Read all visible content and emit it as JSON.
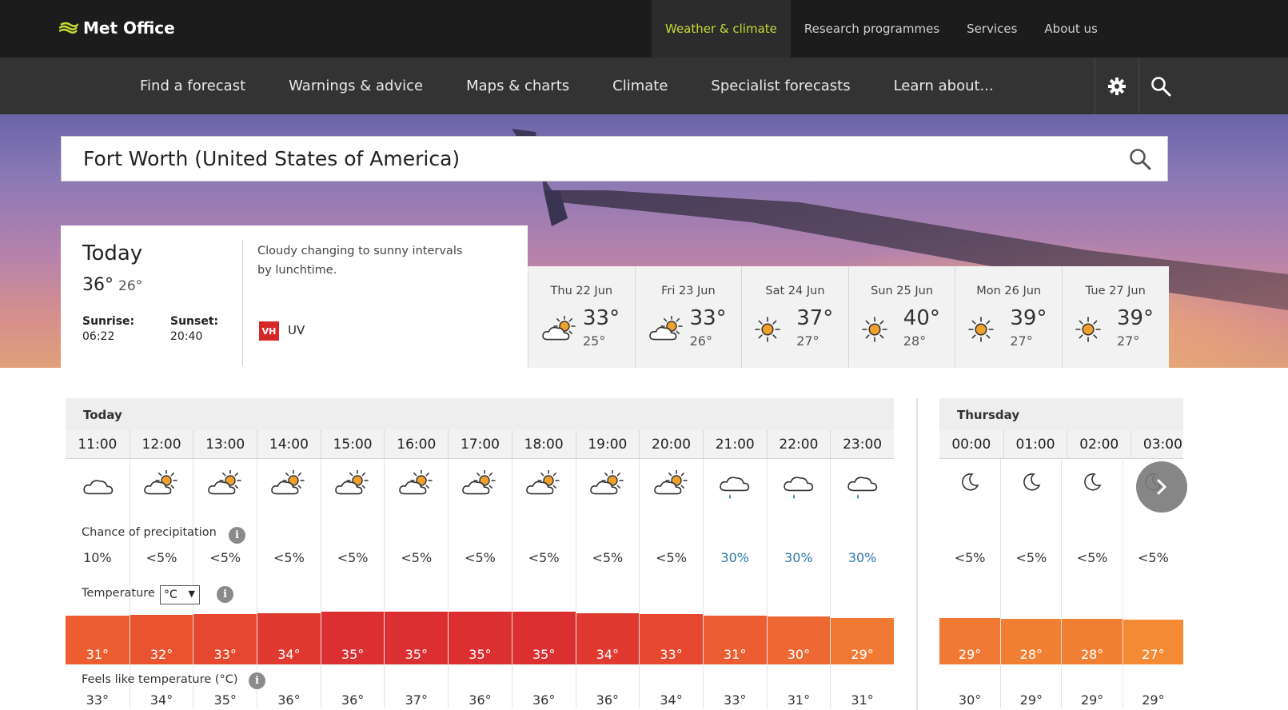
{
  "topnav": {
    "logo_text": "Met Office",
    "links": [
      "Weather & climate",
      "Research programmes",
      "Services",
      "About us"
    ],
    "active_index": 0
  },
  "mainnav": {
    "links": [
      "Find a forecast",
      "Warnings & advice",
      "Maps & charts",
      "Climate",
      "Specialist forecasts",
      "Learn about..."
    ],
    "settings_icon": "gear-icon",
    "search_icon": "search-icon"
  },
  "location_search": {
    "value": "Fort Worth (United States of America)"
  },
  "today": {
    "title": "Today",
    "high": "36°",
    "low": "26°",
    "sunrise_label": "Sunrise:",
    "sunrise": "06:22",
    "sunset_label": "Sunset:",
    "sunset": "20:40",
    "summary": "Cloudy changing to sunny intervals by lunchtime.",
    "uv_badge": "VH",
    "uv_label": "UV",
    "uv_color": "#d62728"
  },
  "days": [
    {
      "label": "Thu 22 Jun",
      "high": "33°",
      "low": "25°",
      "icon": "sunny-intervals-icon"
    },
    {
      "label": "Fri 23 Jun",
      "high": "33°",
      "low": "26°",
      "icon": "sunny-intervals-icon"
    },
    {
      "label": "Sat 24 Jun",
      "high": "37°",
      "low": "27°",
      "icon": "sunny-icon"
    },
    {
      "label": "Sun 25 Jun",
      "high": "40°",
      "low": "28°",
      "icon": "sunny-icon"
    },
    {
      "label": "Mon 26 Jun",
      "high": "39°",
      "low": "27°",
      "icon": "sunny-icon"
    },
    {
      "label": "Tue 27 Jun",
      "high": "39°",
      "low": "27°",
      "icon": "sunny-icon"
    }
  ],
  "hourly_labels": {
    "precip": "Chance of precipitation",
    "temperature": "Temperature",
    "unit": "°C",
    "feels": "Feels like temperature (°C)",
    "info_glyph": "i"
  },
  "today_hourly": {
    "title": "Today",
    "hours": [
      {
        "time": "11:00",
        "icon": "cloudy",
        "precip": "10%",
        "temp": "31°",
        "temp_value": 31,
        "feels": "33°"
      },
      {
        "time": "12:00",
        "icon": "sunny-intervals",
        "precip": "<5%",
        "temp": "32°",
        "temp_value": 32,
        "feels": "34°"
      },
      {
        "time": "13:00",
        "icon": "sunny-intervals",
        "precip": "<5%",
        "temp": "33°",
        "temp_value": 33,
        "feels": "35°"
      },
      {
        "time": "14:00",
        "icon": "sunny-intervals",
        "precip": "<5%",
        "temp": "34°",
        "temp_value": 34,
        "feels": "36°"
      },
      {
        "time": "15:00",
        "icon": "sunny-intervals",
        "precip": "<5%",
        "temp": "35°",
        "temp_value": 35,
        "feels": "36°"
      },
      {
        "time": "16:00",
        "icon": "sunny-intervals",
        "precip": "<5%",
        "temp": "35°",
        "temp_value": 35,
        "feels": "37°"
      },
      {
        "time": "17:00",
        "icon": "sunny-intervals",
        "precip": "<5%",
        "temp": "35°",
        "temp_value": 35,
        "feels": "36°"
      },
      {
        "time": "18:00",
        "icon": "sunny-intervals",
        "precip": "<5%",
        "temp": "35°",
        "temp_value": 35,
        "feels": "36°"
      },
      {
        "time": "19:00",
        "icon": "sunny-intervals",
        "precip": "<5%",
        "temp": "34°",
        "temp_value": 34,
        "feels": "36°"
      },
      {
        "time": "20:00",
        "icon": "sunny-intervals",
        "precip": "<5%",
        "temp": "33°",
        "temp_value": 33,
        "feels": "34°"
      },
      {
        "time": "21:00",
        "icon": "light-shower",
        "precip": "30%",
        "temp": "31°",
        "temp_value": 31,
        "feels": "33°"
      },
      {
        "time": "22:00",
        "icon": "light-shower",
        "precip": "30%",
        "temp": "30°",
        "temp_value": 30,
        "feels": "31°"
      },
      {
        "time": "23:00",
        "icon": "light-shower",
        "precip": "30%",
        "temp": "29°",
        "temp_value": 29,
        "feels": "31°"
      }
    ]
  },
  "thursday_hourly": {
    "title": "Thursday",
    "hours": [
      {
        "time": "00:00",
        "icon": "clear-night",
        "precip": "<5%",
        "temp": "29°",
        "temp_value": 29,
        "feels": "30°"
      },
      {
        "time": "01:00",
        "icon": "clear-night",
        "precip": "<5%",
        "temp": "28°",
        "temp_value": 28,
        "feels": "29°"
      },
      {
        "time": "02:00",
        "icon": "clear-night",
        "precip": "<5%",
        "temp": "28°",
        "temp_value": 28,
        "feels": "29°"
      },
      {
        "time": "03:00",
        "icon": "clear-night",
        "precip": "<5%",
        "temp": "27°",
        "temp_value": 27,
        "feels": "29°"
      }
    ]
  },
  "colors": {
    "accent": "#c6da34",
    "precip_wet": "#2d78a7",
    "temp_35": "#dc2f32",
    "temp_34": "#e0392f",
    "temp_33": "#e5482e",
    "temp_32": "#e9532f",
    "temp_31": "#ec5e31",
    "temp_30": "#ee6833",
    "temp_29": "#f07a34",
    "temp_28": "#f28034",
    "temp_27": "#f48a34"
  },
  "scroll_button_icon": "chevron-right-icon"
}
